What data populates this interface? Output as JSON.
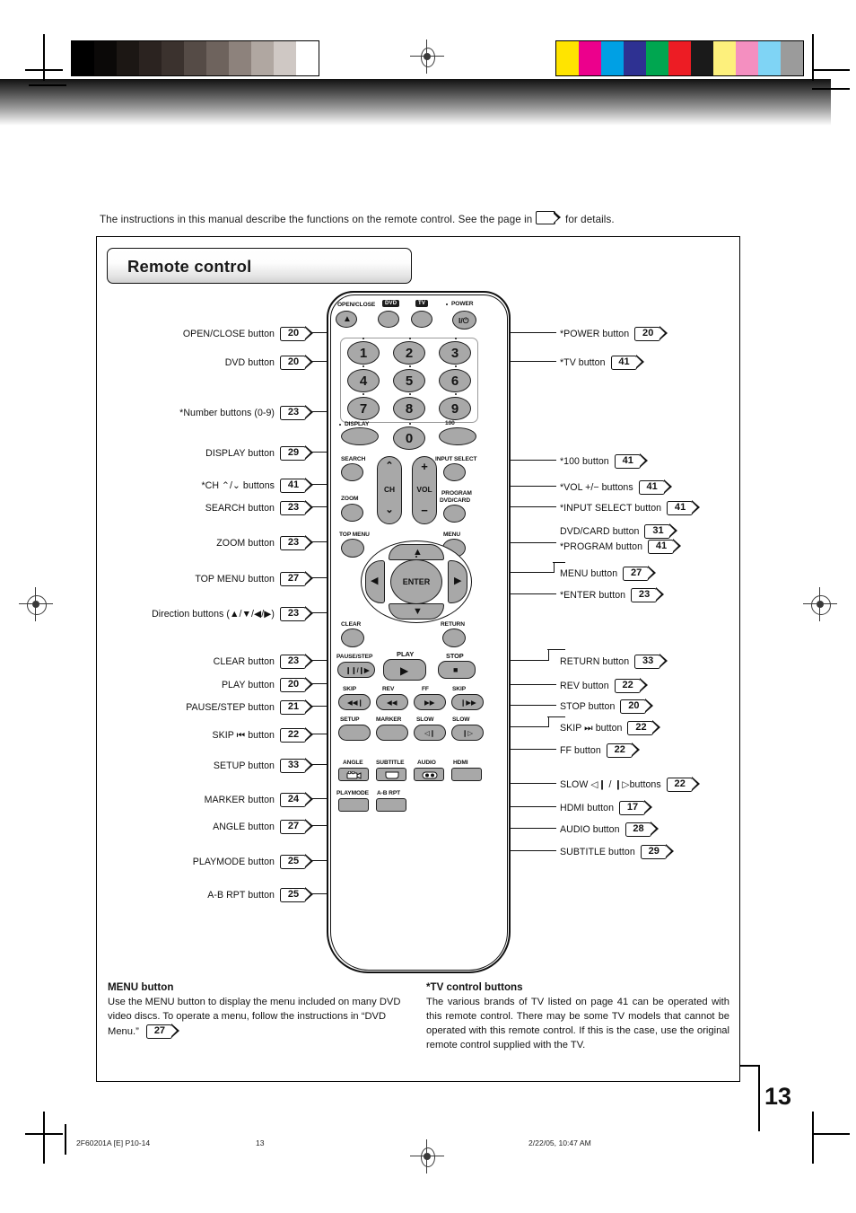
{
  "page": {
    "number": "13",
    "intro": "The instructions in this manual describe the functions on the remote control. See the page in",
    "intro_tail": "for details."
  },
  "panel": {
    "title": "Remote control"
  },
  "footer": {
    "doc_code": "2F60201A [E] P10-14",
    "page_no": "13",
    "timestamp": "2/22/05, 10:47 AM"
  },
  "calibration": {
    "grey_steps": [
      "#000000",
      "#0b0908",
      "#1c1714",
      "#2b2320",
      "#3b322e",
      "#554b46",
      "#6e635d",
      "#8d827c",
      "#b0a7a1",
      "#cfc8c4",
      "#ffffff"
    ],
    "color_steps": [
      "#ffe400",
      "#ec008c",
      "#00a0e4",
      "#2e3192",
      "#00a650",
      "#ed1c24",
      "#1a1a1a",
      "#fdf07c",
      "#f48fc0",
      "#7fd4f5",
      "#9b9b9b"
    ]
  },
  "labels_left": [
    {
      "text": "OPEN/CLOSE button",
      "page": "20",
      "name": "open-close"
    },
    {
      "text": "DVD button",
      "page": "20",
      "name": "dvd"
    },
    {
      "text": "*Number buttons (0-9)",
      "page": "23",
      "name": "number-buttons"
    },
    {
      "text": "DISPLAY button",
      "page": "29",
      "name": "display"
    },
    {
      "text": "*CH ⌃/⌄ buttons",
      "page": "41",
      "name": "ch"
    },
    {
      "text": "SEARCH  button",
      "page": "23",
      "name": "search"
    },
    {
      "text": "ZOOM button",
      "page": "23",
      "name": "zoom"
    },
    {
      "text": "TOP MENU button",
      "page": "27",
      "name": "top-menu"
    },
    {
      "text": "Direction buttons (▲/▼/◀/▶)",
      "page": "23",
      "name": "direction"
    },
    {
      "text": "CLEAR button",
      "page": "23",
      "name": "clear"
    },
    {
      "text": "PLAY button",
      "page": "20",
      "name": "play"
    },
    {
      "text": "PAUSE/STEP button",
      "page": "21",
      "name": "pause-step"
    },
    {
      "text": "SKIP ⏮ button",
      "page": "22",
      "name": "skip-back"
    },
    {
      "text": "SETUP button",
      "page": "33",
      "name": "setup"
    },
    {
      "text": "MARKER button",
      "page": "24",
      "name": "marker"
    },
    {
      "text": "ANGLE button",
      "page": "27",
      "name": "angle"
    },
    {
      "text": "PLAYMODE button",
      "page": "25",
      "name": "playmode"
    },
    {
      "text": "A-B RPT button",
      "page": "25",
      "name": "ab-rpt"
    }
  ],
  "labels_right": [
    {
      "text": "*POWER button",
      "page": "20",
      "name": "power"
    },
    {
      "text": "*TV button",
      "page": "41",
      "name": "tv"
    },
    {
      "text": "*100 button",
      "page": "41",
      "name": "hundred"
    },
    {
      "text": "*VOL +/−  buttons",
      "page": "41",
      "name": "vol"
    },
    {
      "text": "*INPUT SELECT button",
      "page": "41",
      "name": "input-select"
    },
    {
      "text": "DVD/CARD button",
      "page": "31",
      "name": "dvd-card"
    },
    {
      "text": "*PROGRAM button",
      "page": "41",
      "name": "program"
    },
    {
      "text": "MENU button",
      "page": "27",
      "name": "menu"
    },
    {
      "text": "*ENTER button",
      "page": "23",
      "name": "enter"
    },
    {
      "text": "RETURN button",
      "page": "33",
      "name": "return"
    },
    {
      "text": "REV button",
      "page": "22",
      "name": "rev"
    },
    {
      "text": "STOP button",
      "page": "20",
      "name": "stop"
    },
    {
      "text": "SKIP ⏭ button",
      "page": "22",
      "name": "skip-fwd"
    },
    {
      "text": "FF button",
      "page": "22",
      "name": "ff"
    },
    {
      "text": "SLOW ◁❙ / ❙▷buttons",
      "page": "22",
      "name": "slow"
    },
    {
      "text": "HDMI button",
      "page": "17",
      "name": "hdmi"
    },
    {
      "text": "AUDIO button",
      "page": "28",
      "name": "audio"
    },
    {
      "text": "SUBTITLE button",
      "page": "29",
      "name": "subtitle"
    }
  ],
  "remote": {
    "caps": {
      "open_close": "OPEN/CLOSE",
      "dvd_tag": "DVD",
      "tv_tag": "TV",
      "power": "POWER",
      "display": "DISPLAY",
      "hundred": "100",
      "search": "SEARCH",
      "input_select": "INPUT SELECT",
      "zoom": "ZOOM",
      "program": "PROGRAM",
      "dvd_card": "DVD/CARD",
      "top_menu": "TOP MENU",
      "menu": "MENU",
      "ch": "CH",
      "vol": "VOL",
      "vol_plus": "+",
      "vol_minus": "−",
      "enter": "ENTER",
      "clear": "CLEAR",
      "return": "RETURN",
      "pause_step": "PAUSE/STEP",
      "play": "PLAY",
      "stop": "STOP",
      "skip_back": "SKIP",
      "rev": "REV",
      "ff": "FF",
      "skip_fwd": "SKIP",
      "setup": "SETUP",
      "marker": "MARKER",
      "slow_back": "SLOW",
      "slow_fwd": "SLOW",
      "angle": "ANGLE",
      "subtitle": "SUBTITLE",
      "audio": "AUDIO",
      "hdmi": "HDMI",
      "playmode": "PLAYMODE",
      "ab_rpt": "A-B RPT"
    },
    "numbers": [
      "1",
      "2",
      "3",
      "4",
      "5",
      "6",
      "7",
      "8",
      "9",
      "0"
    ],
    "glyphs": {
      "eject": "▲",
      "power": "I/⏻",
      "play": "▶",
      "stop": "■",
      "pause_step": "❙❙/❙▶",
      "skip_back": "◀◀❙",
      "rev": "◀◀",
      "ff": "▶▶",
      "skip_fwd": "❙▶▶",
      "slow_back": "◁❙",
      "slow_fwd": "❙▷",
      "up": "▲",
      "down": "▼",
      "left": "◀",
      "right": "▶",
      "ch_up": "⌃",
      "ch_down": "⌄"
    }
  },
  "notes": {
    "menu": {
      "heading": "MENU button",
      "body_1": "Use the MENU button to display the menu included on many DVD video discs. To operate a menu, follow the instructions in “DVD Menu.”",
      "page": "27"
    },
    "tv": {
      "heading": "*TV control buttons",
      "body": "The various brands of TV listed on page 41 can be operated with this remote control. There may be some TV models that cannot be operated with this remote control. If this is the case, use the original remote control supplied with the TV."
    }
  }
}
